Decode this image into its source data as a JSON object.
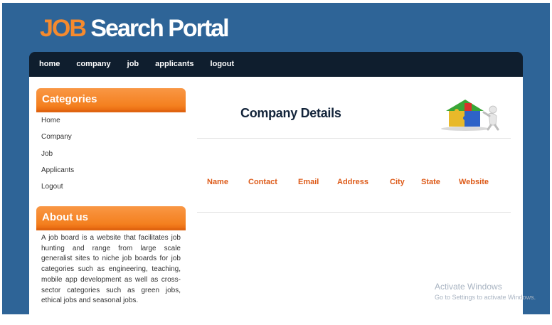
{
  "header": {
    "logo_accent": "JOB",
    "logo_rest": " Search Portal"
  },
  "nav": {
    "items": [
      {
        "label": "home"
      },
      {
        "label": "company"
      },
      {
        "label": "job"
      },
      {
        "label": "applicants"
      },
      {
        "label": "logout"
      }
    ]
  },
  "sidebar": {
    "categories_title": "Categories",
    "items": [
      {
        "label": "Home"
      },
      {
        "label": "Company"
      },
      {
        "label": "Job"
      },
      {
        "label": "Applicants"
      },
      {
        "label": "Logout"
      }
    ],
    "about_title": "About us",
    "about_text": "A job board is a website that facilitates job hunting and range from large scale generalist sites to niche job boards for job categories such as engineering, teaching, mobile app development as well as cross-sector categories such as green jobs, ethical jobs and seasonal jobs."
  },
  "main": {
    "title": "Company Details",
    "table_headers": [
      "Name",
      "Contact",
      "Email",
      "Address",
      "City",
      "State",
      "Website"
    ],
    "illustration_icon": "puzzle-house-icon"
  },
  "watermark": {
    "line1": "Activate Windows",
    "line2": "Go to Settings to activate Windows."
  },
  "colors": {
    "background": "#2e6497",
    "nav_bg": "#0f1e2e",
    "accent": "#f4801f",
    "header_text": "#dd5a18"
  }
}
